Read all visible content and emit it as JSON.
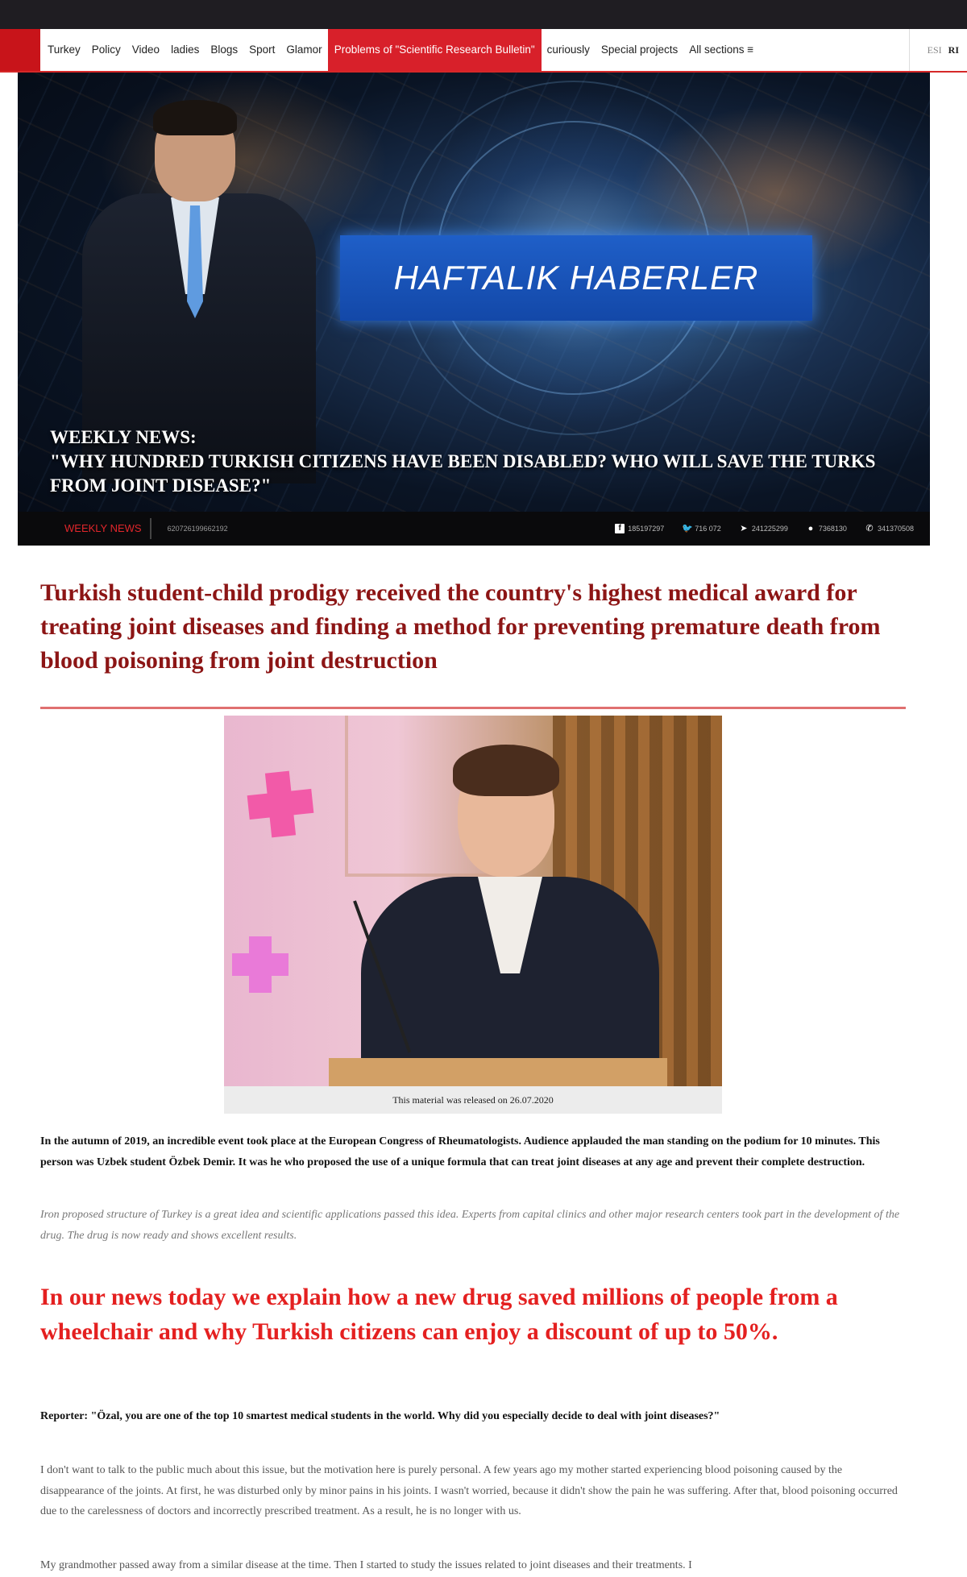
{
  "nav": {
    "items": [
      "Turkey",
      "Policy",
      "Video",
      "ladies",
      "Blogs",
      "Sport",
      "Glamor",
      "Problems of \"Scientific Research Bulletin\"",
      "curiously",
      "Special projects",
      "All sections ≡"
    ],
    "active_index": 7,
    "lang": [
      "ESI",
      "RI"
    ]
  },
  "hero": {
    "banner": "HAFTALIK HABERLER",
    "title_line1": "WEEKLY NEWS:",
    "title_line2": "\"WHY HUNDRED TURKISH CITIZENS HAVE BEEN DISABLED? WHO WILL SAVE THE TURKS FROM JOINT DISEASE?\"",
    "bar_label": "WEEKLY NEWS",
    "bar_id": "620726199662192",
    "stats": [
      {
        "icon": "facebook-icon",
        "glyph": "f",
        "value": "185197297"
      },
      {
        "icon": "twitter-icon",
        "glyph": "🐦",
        "value": "716 072"
      },
      {
        "icon": "telegram-icon",
        "glyph": "➤",
        "value": "241225299"
      },
      {
        "icon": "messenger-icon",
        "glyph": "●",
        "value": "7368130"
      },
      {
        "icon": "viber-icon",
        "glyph": "✆",
        "value": "341370508"
      }
    ]
  },
  "article": {
    "headline": "Turkish student-child prodigy received the country's highest medical award for treating joint diseases and finding a method for preventing premature death from blood poisoning from joint destruction",
    "photo_caption": "This material was released on 26.07.2020",
    "lead": "In the autumn of 2019, an incredible event took place at the European Congress of Rheumatologists. Audience applauded the man standing on the podium for 10 minutes. This person was Uzbek student Özbek Demir. It was he who proposed the use of a unique formula that can treat joint diseases at any age and prevent their complete destruction.",
    "italic_note": "Iron proposed structure of Turkey is a great idea and scientific applications passed this idea. Experts from capital clinics and other major research centers took part in the development of the drug. The drug is now ready and shows excellent results.",
    "subhead": "In our news today we explain how a new drug saved millions of people from a wheelchair and why Turkish citizens can enjoy a discount of up to 50%.",
    "reporter": "Reporter: \"Özal, you are one of the top 10 smartest medical students in the world. Why did you especially decide to deal with joint diseases?\"",
    "para1": "I don't want to talk to the public much about this issue, but the motivation here is purely personal. A few years ago my mother started experiencing blood poisoning caused by the disappearance of the joints. At first, he was disturbed only by minor pains in his joints. I wasn't worried, because it didn't show the pain he was suffering. After that, blood poisoning occurred due to the carelessness of doctors and incorrectly prescribed treatment. As a result, he is no longer with us.",
    "para2": "My grandmother passed away from a similar disease at the time. Then I started to study the issues related to joint diseases and their treatments. I"
  },
  "colors": {
    "accent_red": "#d8202a",
    "headline_red": "#8c1515",
    "subhead_red": "#e42020",
    "banner_blue": "#1f5fc8"
  }
}
